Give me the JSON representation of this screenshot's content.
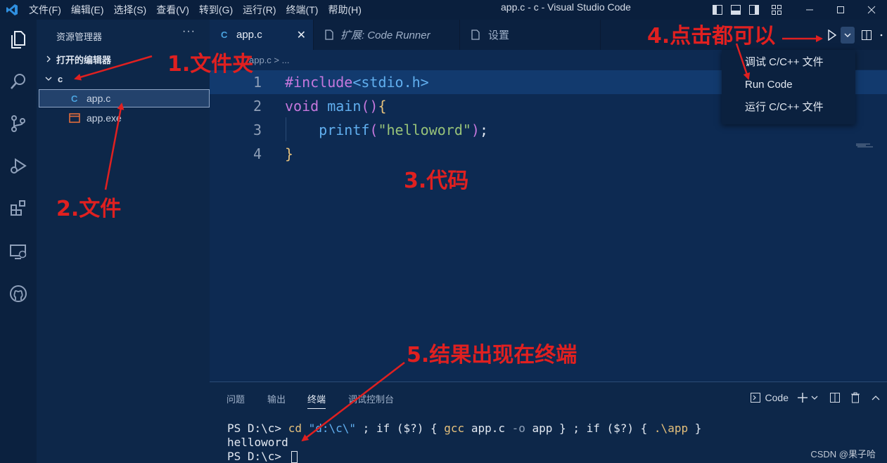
{
  "titlebar": {
    "menu": [
      "文件(F)",
      "编辑(E)",
      "选择(S)",
      "查看(V)",
      "转到(G)",
      "运行(R)",
      "终端(T)",
      "帮助(H)"
    ],
    "title": "app.c - c - Visual Studio Code"
  },
  "sidebar": {
    "header": "资源管理器",
    "open_editors": "打开的编辑器",
    "folder": "c",
    "files": [
      {
        "name": "app.c",
        "type": "c",
        "selected": true
      },
      {
        "name": "app.exe",
        "type": "exe",
        "selected": false
      }
    ]
  },
  "tabs": [
    {
      "label": "app.c",
      "active": true
    },
    {
      "label": "扩展: Code Runner",
      "active": false
    },
    {
      "label": "设置",
      "active": false
    }
  ],
  "breadcrumb": "app.c > ...",
  "editor": {
    "line_numbers": [
      "1",
      "2",
      "3",
      "4"
    ],
    "line1": {
      "kw": "#include",
      "header": "<stdio.h>"
    },
    "line2": {
      "kw": "void",
      "fn": "main",
      "open": "()",
      "brace": "{"
    },
    "line3": {
      "fn": "printf",
      "open": "(",
      "str": "\"helloword\"",
      "close": ")",
      "semi": ";"
    },
    "line4": {
      "brace": "}"
    }
  },
  "run_dropdown": {
    "items": [
      "调试 C/C++ 文件",
      "Run Code",
      "运行 C/C++ 文件"
    ]
  },
  "panel": {
    "tabs": [
      "问题",
      "输出",
      "终端",
      "调试控制台"
    ],
    "active_tab": "终端",
    "terminal_profile": "Code",
    "terminal": {
      "line1": {
        "prompt": "PS D:\\c> ",
        "cmd": "cd ",
        "arg": "\"d:\\c\\\"",
        "rest1": " ; if ($?) { ",
        "gcc": "gcc",
        "rest2": " app.c ",
        "flag": "-o",
        "rest3": " app } ; if ($?) { ",
        "run": ".\\app",
        "rest4": " }"
      },
      "line2": "helloword",
      "line3": "PS D:\\c> "
    }
  },
  "annotations": {
    "a1": "1.文件夹",
    "a2": "2.文件",
    "a3": "3.代码",
    "a4": "4.点击都可以",
    "a5": "5.结果出现在终端"
  },
  "watermark": "CSDN @果子哈",
  "colors": {
    "background": "#0d2a52",
    "annotation": "#e02020",
    "accent": "#4aa3df"
  }
}
